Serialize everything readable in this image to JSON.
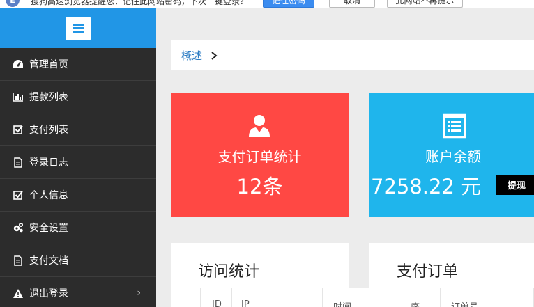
{
  "password_bar": {
    "logo": "E",
    "message": "搜狗高速浏览器提醒您：记住此网站密码，下次一键登录？",
    "save_button": "记住密码",
    "cancel_button": "取消",
    "never_button": "此网站不再提示"
  },
  "sidebar": {
    "items": [
      {
        "label": "管理首页",
        "icon": "dashboard-icon"
      },
      {
        "label": "提款列表",
        "icon": "bar-chart-icon"
      },
      {
        "label": "支付列表",
        "icon": "checkbox-icon"
      },
      {
        "label": "登录日志",
        "icon": "document-icon"
      },
      {
        "label": "个人信息",
        "icon": "checkbox-icon"
      },
      {
        "label": "安全设置",
        "icon": "gears-icon"
      },
      {
        "label": "支付文档",
        "icon": "document-icon"
      },
      {
        "label": "退出登录",
        "icon": "warning-icon"
      }
    ]
  },
  "breadcrumb": {
    "current": "概述"
  },
  "cards": {
    "orders": {
      "title": "支付订单统计",
      "value": "12条",
      "color": "#ff4844"
    },
    "balance": {
      "title": "账户余额",
      "value": "7258.22 元",
      "withdraw_label": "提现",
      "color": "#1fb5ec"
    }
  },
  "panels": {
    "visits": {
      "title": "访问统计",
      "columns": [
        "ID",
        "IP",
        "时间"
      ]
    },
    "payments": {
      "title": "支付订单",
      "columns": [
        "序",
        "订单号"
      ]
    }
  },
  "colors": {
    "sidebar_bg": "#2c2c2c",
    "sidebar_head": "#2196e6",
    "link": "#2d7dc4"
  }
}
